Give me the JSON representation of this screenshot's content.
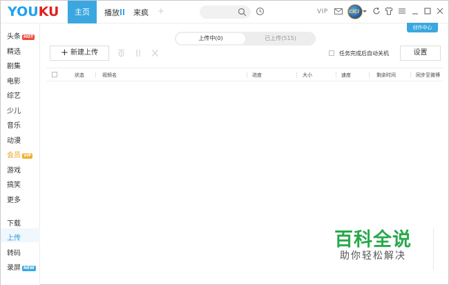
{
  "header": {
    "logo_you": "YOU",
    "logo_ku": "KU",
    "nav_home": "主页",
    "nav_play": "播放",
    "nav_laifeng": "来疯",
    "nav_plus": "+",
    "vip_label": "VIP",
    "avatar_text": "CiCi"
  },
  "sidebar": {
    "items": [
      {
        "label": "头条",
        "badge": "HOT"
      },
      {
        "label": "精选"
      },
      {
        "label": "剧集"
      },
      {
        "label": "电影"
      },
      {
        "label": "综艺"
      },
      {
        "label": "少儿"
      },
      {
        "label": "音乐"
      },
      {
        "label": "动漫"
      },
      {
        "label": "会员",
        "badge": "VIP"
      },
      {
        "label": "游戏"
      },
      {
        "label": "搞笑"
      },
      {
        "label": "更多"
      },
      {
        "label": "下载"
      },
      {
        "label": "上传",
        "active": true
      },
      {
        "label": "转码"
      },
      {
        "label": "录屏",
        "badge": "NEW"
      }
    ]
  },
  "main": {
    "creator_center": "创作中心",
    "tabs": [
      {
        "label": "上传中(0)",
        "active": true
      },
      {
        "label": "已上传(515)",
        "active": false
      }
    ],
    "new_upload_label": "新建上传",
    "auto_shutdown_label": "任务完成后自动关机",
    "settings_label": "设置",
    "table_headers": [
      "状态",
      "视频名",
      "进度",
      "大小",
      "速度",
      "剩余时间",
      "同步至微博"
    ]
  },
  "watermark": {
    "title": "百科全说",
    "subtitle": "助你轻松解决"
  },
  "colors": {
    "accent": "#3aa7e0",
    "logo_blue": "#1da1f2",
    "logo_red": "#e02020",
    "vip": "#e8a21a",
    "watermark_green": "#27a94a"
  }
}
